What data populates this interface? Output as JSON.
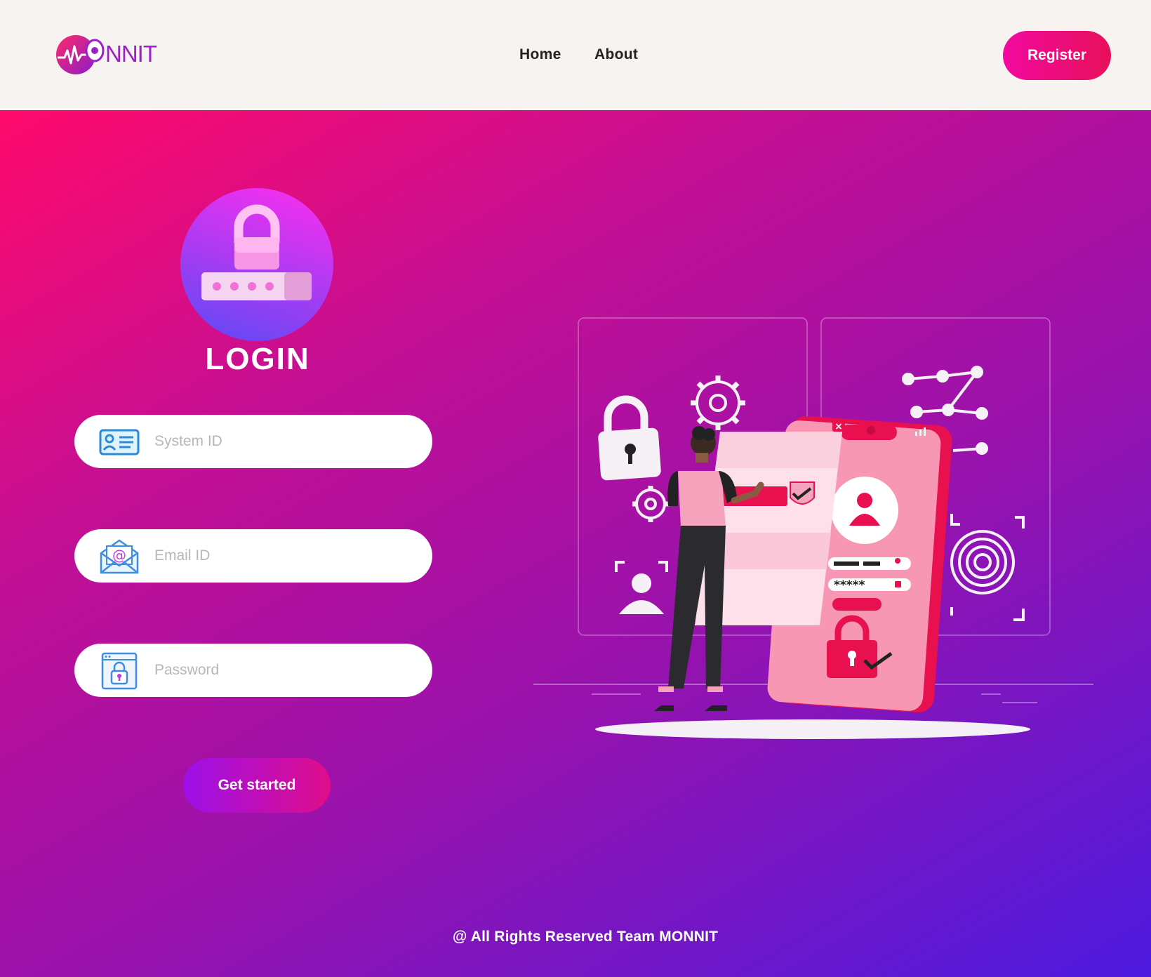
{
  "header": {
    "logo_text": "NNIT",
    "nav": {
      "home": "Home",
      "about": "About"
    },
    "register_label": "Register"
  },
  "login": {
    "title": "LOGIN",
    "fields": [
      {
        "placeholder": "System ID",
        "icon": "id-card-icon"
      },
      {
        "placeholder": "Email ID",
        "icon": "email-icon"
      },
      {
        "placeholder": "Password",
        "icon": "password-lock-icon"
      }
    ],
    "submit_label": "Get started"
  },
  "footer": {
    "text": "@ All Rights Reserved Team MONNIT"
  },
  "colors": {
    "header_bg": "#f7f3f0",
    "gradient_start": "#ff0a6c",
    "gradient_mid": "#9812ad",
    "gradient_end": "#4d1be0",
    "register_button": "#f20aa0",
    "accent_red": "#e8104f"
  }
}
